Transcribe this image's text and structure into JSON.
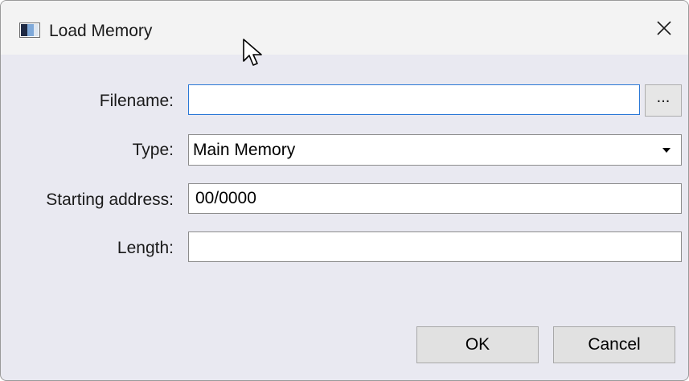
{
  "window": {
    "title": "Load Memory",
    "icon": "application-window-icon"
  },
  "form": {
    "filename": {
      "label": "Filename:",
      "value": ""
    },
    "browse_label": "...",
    "type": {
      "label": "Type:",
      "value": "Main Memory"
    },
    "starting_address": {
      "label": "Starting address:",
      "value": "00/0000"
    },
    "length": {
      "label": "Length:",
      "value": ""
    }
  },
  "buttons": {
    "ok": "OK",
    "cancel": "Cancel"
  },
  "colors": {
    "dialog_background": "#e9e9f1",
    "titlebar_background": "#f3f3f3",
    "focus_border": "#2a78d6"
  }
}
